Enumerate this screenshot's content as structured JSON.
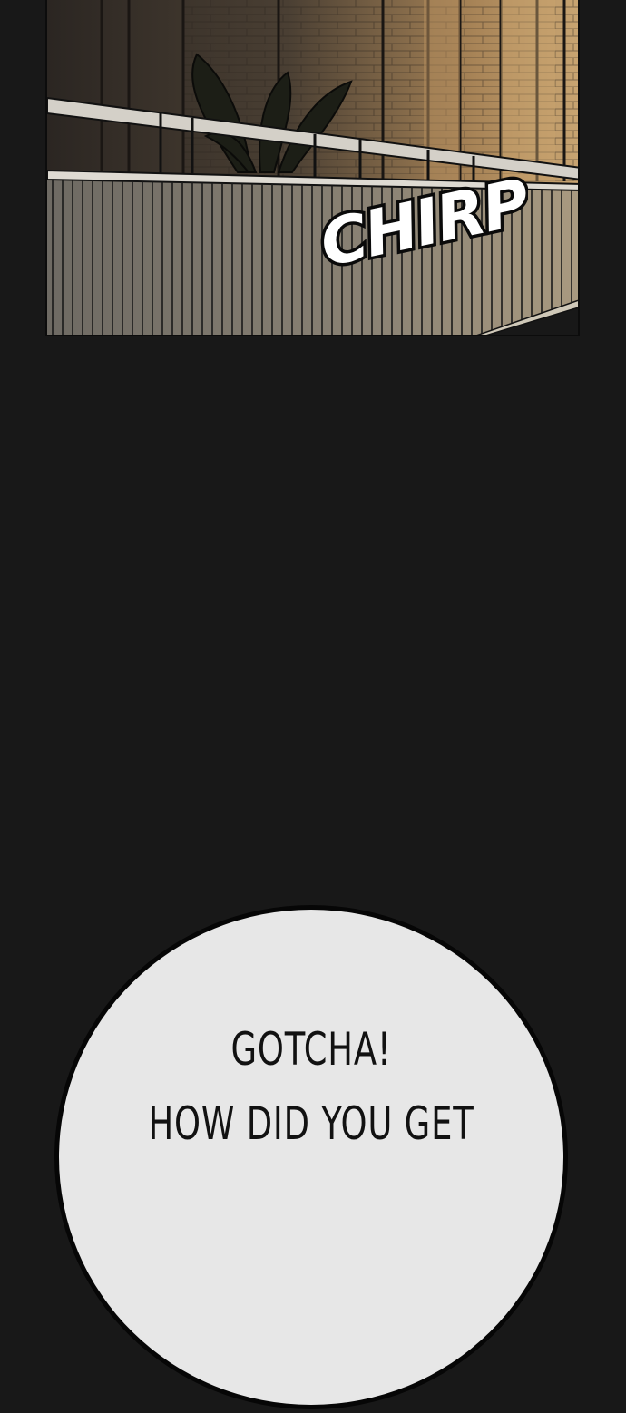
{
  "panel": {
    "scene": "balcony railing at dusk",
    "sfx": "CHIRP"
  },
  "bubble": {
    "line1": "GOTCHA!",
    "line2": "HOW DID YOU GET"
  },
  "colors": {
    "background": "#181818",
    "bubble_fill": "#e7e7e7",
    "bubble_outline": "#060606",
    "warm_light": "#c29a6a"
  }
}
